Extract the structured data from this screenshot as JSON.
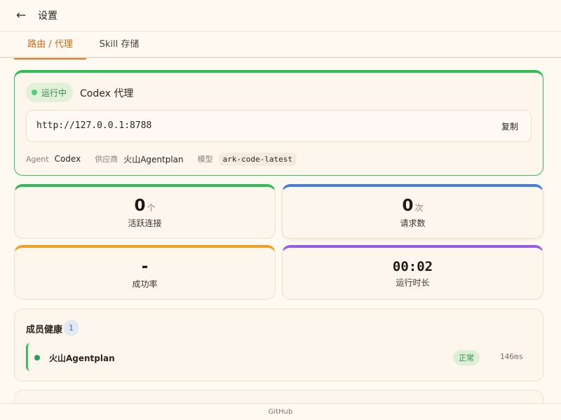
{
  "header": {
    "back_icon": "←",
    "title": "设置"
  },
  "tabs": [
    {
      "label": "路由 / 代理",
      "active": true
    },
    {
      "label": "Skill 存储",
      "active": false
    }
  ],
  "proxy": {
    "status": "运行中",
    "name": "Codex 代理",
    "url": "http://127.0.0.1:8788",
    "copy_label": "复制",
    "meta": {
      "agent_key": "Agent",
      "agent_value": "Codex",
      "provider_key": "供应商",
      "provider_value": "火山Agentplan",
      "model_key": "模型",
      "model_value": "ark-code-latest"
    },
    "accent_color": "#2fbd57"
  },
  "stats": {
    "active_connections": {
      "value": "0",
      "unit": "个",
      "label": "活跃连接",
      "color": "#2fbd57"
    },
    "requests": {
      "value": "0",
      "unit": "次",
      "label": "请求数",
      "color": "#3f7fe6"
    },
    "success_rate": {
      "value": "-",
      "label": "成功率",
      "color": "#f0a022"
    },
    "uptime": {
      "value": "00:02",
      "label": "运行时长",
      "color": "#9b5de0"
    }
  },
  "health": {
    "title": "成员健康",
    "count": "1",
    "members": [
      {
        "name": "火山Agentplan",
        "status": "正常",
        "latency": "146ms"
      }
    ]
  },
  "footer": {
    "link": "GitHub"
  }
}
